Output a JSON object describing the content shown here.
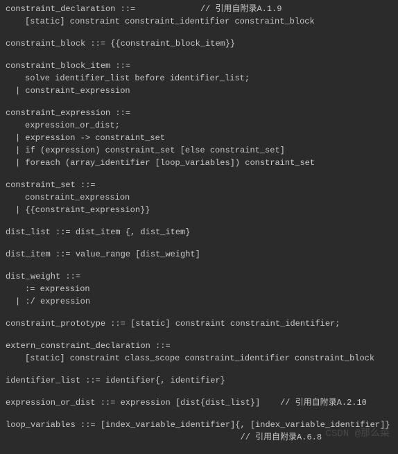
{
  "rules": [
    {
      "lines": [
        {
          "text": "constraint_declaration ::=             // 引用自附录A.1.9",
          "indent": false
        },
        {
          "text": "[static] constraint constraint_identifier constraint_block",
          "indent": true
        }
      ]
    },
    {
      "lines": [
        {
          "text": "constraint_block ::= {{constraint_block_item}}",
          "indent": false
        }
      ]
    },
    {
      "lines": [
        {
          "text": "constraint_block_item ::=",
          "indent": false
        },
        {
          "text": "solve identifier_list before identifier_list;",
          "indent": true
        },
        {
          "text": "| constraint_expression",
          "indent": true,
          "lessIndent": true
        }
      ]
    },
    {
      "lines": [
        {
          "text": "constraint_expression ::=",
          "indent": false
        },
        {
          "text": "expression_or_dist;",
          "indent": true
        },
        {
          "text": "| expression -> constraint_set",
          "indent": true,
          "lessIndent": true
        },
        {
          "text": "| if (expression) constraint_set [else constraint_set]",
          "indent": true,
          "lessIndent": true
        },
        {
          "text": "| foreach (array_identifier [loop_variables]) constraint_set",
          "indent": true,
          "lessIndent": true
        }
      ]
    },
    {
      "lines": [
        {
          "text": "constraint_set ::=",
          "indent": false
        },
        {
          "text": "constraint_expression",
          "indent": true
        },
        {
          "text": "| {{constraint_expression}}",
          "indent": true,
          "lessIndent": true
        }
      ]
    },
    {
      "lines": [
        {
          "text": "dist_list ::= dist_item {, dist_item}",
          "indent": false
        }
      ]
    },
    {
      "lines": [
        {
          "text": "dist_item ::= value_range [dist_weight]",
          "indent": false
        }
      ]
    },
    {
      "lines": [
        {
          "text": "dist_weight ::=",
          "indent": false
        },
        {
          "text": ":= expression",
          "indent": true
        },
        {
          "text": "| :/ expression",
          "indent": true,
          "lessIndent": true
        }
      ]
    },
    {
      "lines": [
        {
          "text": "constraint_prototype ::= [static] constraint constraint_identifier;",
          "indent": false
        }
      ]
    },
    {
      "lines": [
        {
          "text": "extern_constraint_declaration ::=",
          "indent": false
        },
        {
          "text": "[static] constraint class_scope constraint_identifier constraint_block",
          "indent": true
        }
      ]
    },
    {
      "lines": [
        {
          "text": "identifier_list ::= identifier{, identifier}",
          "indent": false
        }
      ]
    },
    {
      "lines": [
        {
          "text": "expression_or_dist ::= expression [dist{dist_list}]    // 引用自附录A.2.10",
          "indent": false
        }
      ]
    },
    {
      "lines": [
        {
          "text": "loop_variables ::= [index_variable_identifier]{, [index_variable_identifier]}",
          "indent": false
        },
        {
          "text": "                                               // 引用自附录A.6.8",
          "indent": false
        }
      ]
    }
  ],
  "watermark": "CSDN @那么菜"
}
